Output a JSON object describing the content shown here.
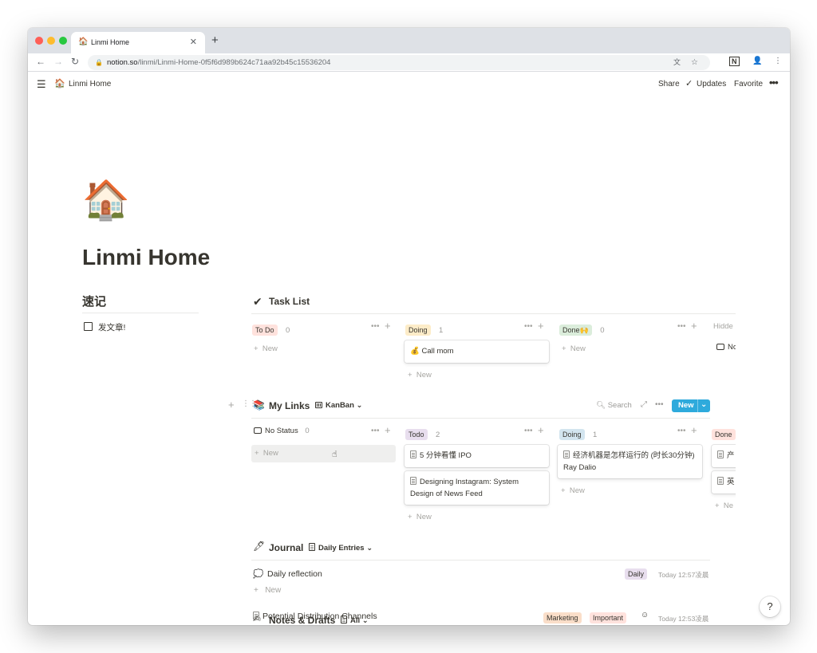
{
  "browser": {
    "tab_title": "Linmi Home",
    "tab_favicon": "🏠",
    "url_host": "notion.so",
    "url_path": "/linmi/Linmi-Home-0f5f6d989b624c71aa92b45c15536204"
  },
  "topbar": {
    "page_icon": "🏠",
    "breadcrumb": "Linmi Home",
    "share": "Share",
    "updates": "Updates",
    "favorite": "Favorite"
  },
  "page": {
    "icon": "🏠",
    "title": "Linmi Home"
  },
  "quick_notes": {
    "heading": "速记",
    "todo_text": "发文章!"
  },
  "task_list": {
    "icon": "✔",
    "title": "Task List",
    "columns": [
      {
        "label": "To Do",
        "count": "0",
        "color": "#ffe2dd",
        "new_label": "New"
      },
      {
        "label": "Doing",
        "count": "1",
        "color": "#fdecc8",
        "new_label": "New",
        "cards": [
          {
            "emoji": "💰",
            "text": "Call mom"
          }
        ]
      },
      {
        "label": "Done🙌",
        "count": "0",
        "color": "#dbeddb",
        "new_label": "New"
      },
      {
        "label": "Hidde",
        "card_text": "No"
      }
    ]
  },
  "my_links": {
    "icon": "📚",
    "title": "My Links",
    "view": "KanBan",
    "search": "Search",
    "new_button": "New",
    "columns": [
      {
        "label": "No Status",
        "count": "0",
        "new_label": "New"
      },
      {
        "label": "Todo",
        "count": "2",
        "color": "#e8deee",
        "new_label": "New",
        "cards": [
          "5 分钟看懂 IPO",
          "Designing Instagram: System Design of News Feed"
        ]
      },
      {
        "label": "Doing",
        "count": "1",
        "color": "#d3e5ef",
        "new_label": "New",
        "cards": [
          "经济机器是怎样运行的 (时长30分钟) Ray Dalio"
        ]
      },
      {
        "label": "Done",
        "color": "#ffe2dd",
        "new_label": "Ne",
        "cards": [
          "产",
          "英"
        ]
      }
    ]
  },
  "journal": {
    "icon": "🖋",
    "title": "Journal",
    "view": "Daily Entries",
    "rows": [
      {
        "icon": "💭",
        "title": "Daily reflection",
        "tag": "Daily",
        "tag_color": "#e8deee",
        "time": "Today 12:57凌晨"
      }
    ],
    "new_label": "New"
  },
  "notes": {
    "icon": "✍",
    "title": "Notes & Drafts",
    "view": "All",
    "rows": [
      {
        "title": "Potential Distribution Channels",
        "tags": [
          "Marketing",
          "Important"
        ],
        "tag_colors": [
          "#fadec9",
          "#ffe2dd"
        ],
        "time": "Today 12:53凌晨"
      }
    ]
  },
  "help_button": "?"
}
